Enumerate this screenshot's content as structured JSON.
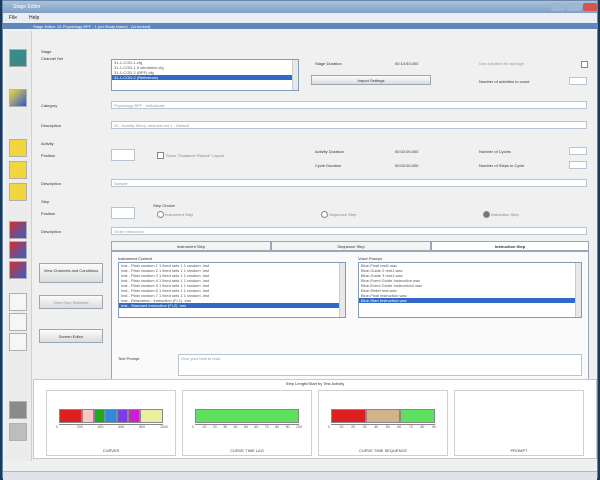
{
  "window": {
    "title": "Stage Editor"
  },
  "inner_title": "Stage Editor: 31 Physiology BPF - 1 (ed.Study.Name) - [Unlocked]",
  "menu": [
    "File",
    "Help"
  ],
  "stage": {
    "label": "Stage",
    "channel_set_label": "Channel Set",
    "channel_items": [
      "31-1-COD-1.cfg",
      "31-1-COD-1.5 stimlation.cfg",
      "31-1-COD-2 (BPF).cfg",
      "31-1-COD-2 (Reference)"
    ],
    "stage_duration_label": "Stage Duration",
    "stage_duration_value": "00:14:53.000",
    "import_settings_btn": "Import Settings",
    "use_activities_label": "Use activities for average",
    "num_activities_label": "Number of activities to count",
    "category_label": "Category",
    "category_value": "Physiology BPF - Individuals",
    "description_label": "Description",
    "description_value": "31 - Activity Sleep, stimulus set 1 - Default"
  },
  "activity": {
    "label": "Activity",
    "position_label": "Position",
    "show_checkbox": "Show \"Guidance Repeat\" Layout",
    "activity_duration_label": "Activity Duration",
    "activity_duration_value": "00:02:00.000",
    "cycle_duration_label": "Cycle Duration",
    "cycle_duration_value": "00:02:00.000",
    "num_cycles_label": "Number of Cycles",
    "num_steps_label": "Number of Steps in Cycle",
    "description_label": "Description",
    "description_value": "Sample"
  },
  "step": {
    "label": "Step",
    "position_label": "Position",
    "step_choice_label": "Step Choice",
    "options": [
      "Instrument Step",
      "Sequence Step",
      "Instruction Step"
    ],
    "description_label": "Description",
    "description_value": "Order Instruction"
  },
  "left_buttons": [
    "View Channels and Conditions",
    "View Step Statistics",
    "Screen Editor"
  ],
  "tabs": [
    "Instrument Step",
    "Sequence Step",
    "Instruction Step"
  ],
  "panel": {
    "instrument_content_label": "Instrument Content",
    "instrument_items": [
      "Inst - Plain random 1 1 fixed sets 1 1 random .inst",
      "Inst - Plain random 2 1 fixed sets 1 1 random .inst",
      "Inst - Plain random 3 1 fixed sets 1 1 random .inst",
      "Inst - Plain random 4 1 fixed sets 1 1 random .inst",
      "Inst - Plain random 5 1 fixed sets 1 1 random .inst",
      "Inst - Plain random 6 1 fixed sets 1 1 random .inst",
      "Inst - Plain random 7 1 fixed sets 1 1 random .inst",
      "Inst - Relaxation - instruction (Fi-1) .inst",
      "Inst - Standard Instruction (Fi-2) .inst"
    ],
    "voice_prompt_label": "Voice Prompt",
    "voice_items": [
      "Blue-Final rest1.wav",
      "Blue-Guide 2 rest1.wav",
      "Blue-Guide 3 rest1.wav",
      "Blue-Event Guide Instruction.wav",
      "Blue-Event Guide Instruction2.wav",
      "Blue-Relief rest.wav",
      "Blue-Final instruction.wav",
      "Blue-Start Instruction.wav"
    ],
    "text_prompt_label": "Text Prompt",
    "text_prompt_value": "Give your best to read"
  },
  "charts_title": "Step Length/Start by Test Activity",
  "chart_data": [
    {
      "type": "bar",
      "title": "CURVES",
      "segments": [
        {
          "color": "#e02020",
          "value": 100
        },
        {
          "color": "#f7c6c6",
          "value": 50
        },
        {
          "color": "#1fa81f",
          "value": 50
        },
        {
          "color": "#2a8be0",
          "value": 50
        },
        {
          "color": "#7a3fe0",
          "value": 50
        },
        {
          "color": "#d01fd0",
          "value": 50
        },
        {
          "color": "#e8f0a0",
          "value": 100
        }
      ],
      "ticks": [
        "0",
        "200",
        "400",
        "600",
        "800",
        "1000"
      ],
      "xlim": [
        0,
        1000
      ]
    },
    {
      "type": "bar",
      "title": "CURVE TIME LAG",
      "segments": [
        {
          "color": "#5fe05f",
          "value": 100
        }
      ],
      "ticks": [
        "0",
        "10",
        "20",
        "30",
        "40",
        "50",
        "60",
        "70",
        "80",
        "90",
        "100"
      ],
      "xlim": [
        0,
        100
      ]
    },
    {
      "type": "bar",
      "title": "CURVE TIME SEQUENCE",
      "segments": [
        {
          "color": "#e02020",
          "value": 30
        },
        {
          "color": "#d2b48c",
          "value": 30
        },
        {
          "color": "#5fe05f",
          "value": 30
        }
      ],
      "ticks": [
        "0",
        "10",
        "20",
        "30",
        "40",
        "50",
        "60",
        "70",
        "80",
        "90"
      ],
      "xlim": [
        0,
        90
      ]
    },
    {
      "type": "bar",
      "title": "PROMPT",
      "segments": [],
      "ticks": [],
      "xlim": [
        0,
        1
      ]
    }
  ]
}
